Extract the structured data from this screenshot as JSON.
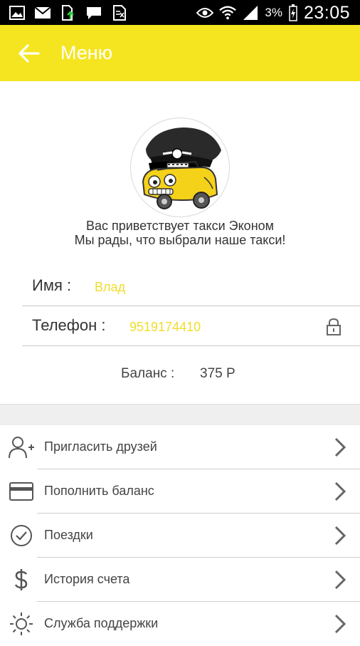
{
  "statusbar": {
    "battery_percent": "3%",
    "time": "23:05",
    "icons": [
      "image-icon",
      "mail-icon",
      "file-upload-icon",
      "chat-icon",
      "document-icon",
      "eye-icon",
      "wifi-icon",
      "signal-icon",
      "battery-charging-icon"
    ]
  },
  "appbar": {
    "title": "Меню",
    "back_icon": "arrow-left-icon",
    "background": "#f5e520"
  },
  "profile": {
    "logo": "taxi-econom-logo",
    "welcome_line1": "Вас приветствует такси Эконом",
    "welcome_line2": "Мы рады, что выбрали наше такси!",
    "name_label": "Имя :",
    "name_value": "Влад",
    "phone_label": "Телефон :",
    "phone_value": "9519174410",
    "phone_lock_icon": "lock-icon",
    "balance_label": "Баланс :",
    "balance_value": "375 Р",
    "accent_color": "#f0dd2a"
  },
  "menu": {
    "items": [
      {
        "label": "Пригласить друзей",
        "icon": "add-user-icon"
      },
      {
        "label": "Пополнить баланс",
        "icon": "credit-card-icon"
      },
      {
        "label": "Поездки",
        "icon": "check-circle-icon"
      },
      {
        "label": "История счета",
        "icon": "dollar-icon"
      },
      {
        "label": "Служба поддержки",
        "icon": "sun-icon"
      }
    ]
  }
}
